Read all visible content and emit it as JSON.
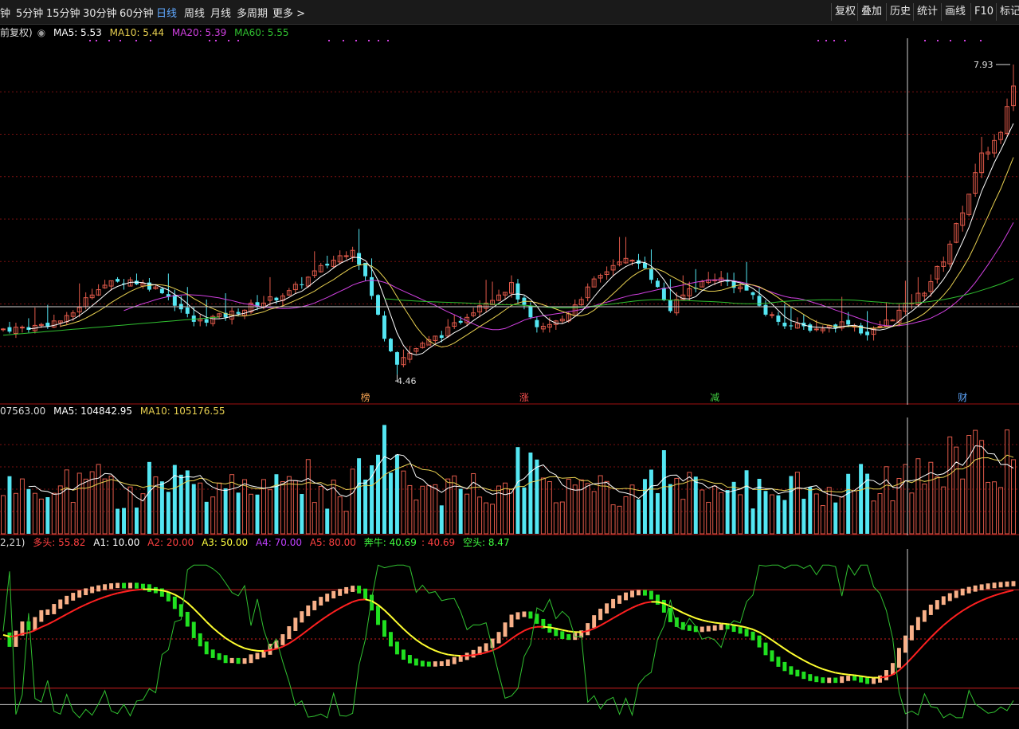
{
  "toolbar": {
    "periods": [
      "钟",
      "5分钟",
      "15分钟",
      "30分钟",
      "60分钟",
      "日线",
      "周线",
      "月线",
      "多周期",
      "更多 >"
    ],
    "active": "日线",
    "right_buttons": [
      "复权",
      "叠加",
      "历史",
      "统计",
      "画线",
      "F10",
      "标记"
    ]
  },
  "colors": {
    "up": "#e25a4a",
    "down": "#54e6f2",
    "ma5": "#ffffff",
    "ma10": "#e8d050",
    "ma20": "#d040e0",
    "ma60": "#30c030",
    "bg": "#000000",
    "grid": "#7a1010"
  },
  "price_legend": {
    "prefix": "前复权)",
    "ma5": "MA5: 5.53",
    "ma10": "MA10: 5.44",
    "ma20": "MA20: 5.39",
    "ma60": "MA60: 5.55"
  },
  "volume_legend": {
    "vol": "07563.00",
    "ma5": "MA5: 104842.95",
    "ma10": "MA10: 105176.55"
  },
  "indicator_legend": {
    "params": "2,21)",
    "duotou": "多头: 55.82",
    "a1": "A1: 10.00",
    "a2": "A2: 20.00",
    "a3": "A3: 50.00",
    "a4": "A4: 70.00",
    "a5": "A5: 80.00",
    "benniu": "奔牛: 40.69",
    "benniu2": ": 40.69",
    "kongtou": "空头: 8.47"
  },
  "price_annotations": {
    "high": "7.93",
    "low": "4.46"
  },
  "event_markers": [
    {
      "label": "榜",
      "color": "#f0a050",
      "index": 57
    },
    {
      "label": "涨",
      "color": "#ff5050",
      "index": 82
    },
    {
      "label": "减",
      "color": "#40d040",
      "index": 112
    },
    {
      "label": "财",
      "color": "#5fa8ff",
      "index": 151
    }
  ],
  "chart_data": {
    "type": "candlestick",
    "ohlc": [],
    "price_range": [
      4.3,
      8.1
    ],
    "volume_range": [
      0,
      180000
    ],
    "indicator_range": [
      0,
      100
    ]
  }
}
